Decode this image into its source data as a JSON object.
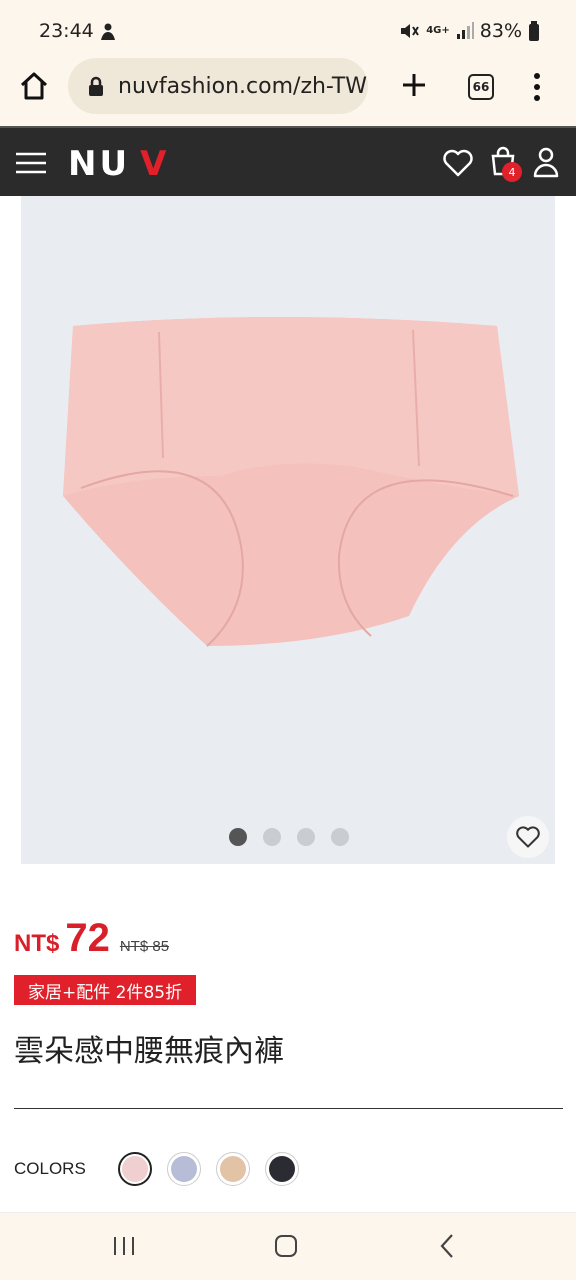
{
  "status_bar": {
    "time": "23:44",
    "battery": "83%",
    "network": "4G+"
  },
  "browser": {
    "url": "nuvfashion.com/zh-TW",
    "tab_count": "66"
  },
  "site_header": {
    "logo_nu": "NU",
    "logo_v": "V",
    "cart_count": "4"
  },
  "gallery": {
    "slide_count": 4,
    "active_slide": 1
  },
  "product": {
    "price_currency": "NT$",
    "price": "72",
    "original_price": "NT$ 85",
    "promo": "家居+配件 2件85折",
    "title": "雲朵感中腰無痕內褲"
  },
  "colors": {
    "label": "COLORS",
    "swatches": [
      "#f0cfd0",
      "#b7bdd6",
      "#e3c3a6",
      "#2b2b33"
    ],
    "selected_index": 0
  },
  "theme": {
    "accent": "#e0202b",
    "header_bg": "#2b2b2b",
    "image_bg": "#e9edf2"
  }
}
